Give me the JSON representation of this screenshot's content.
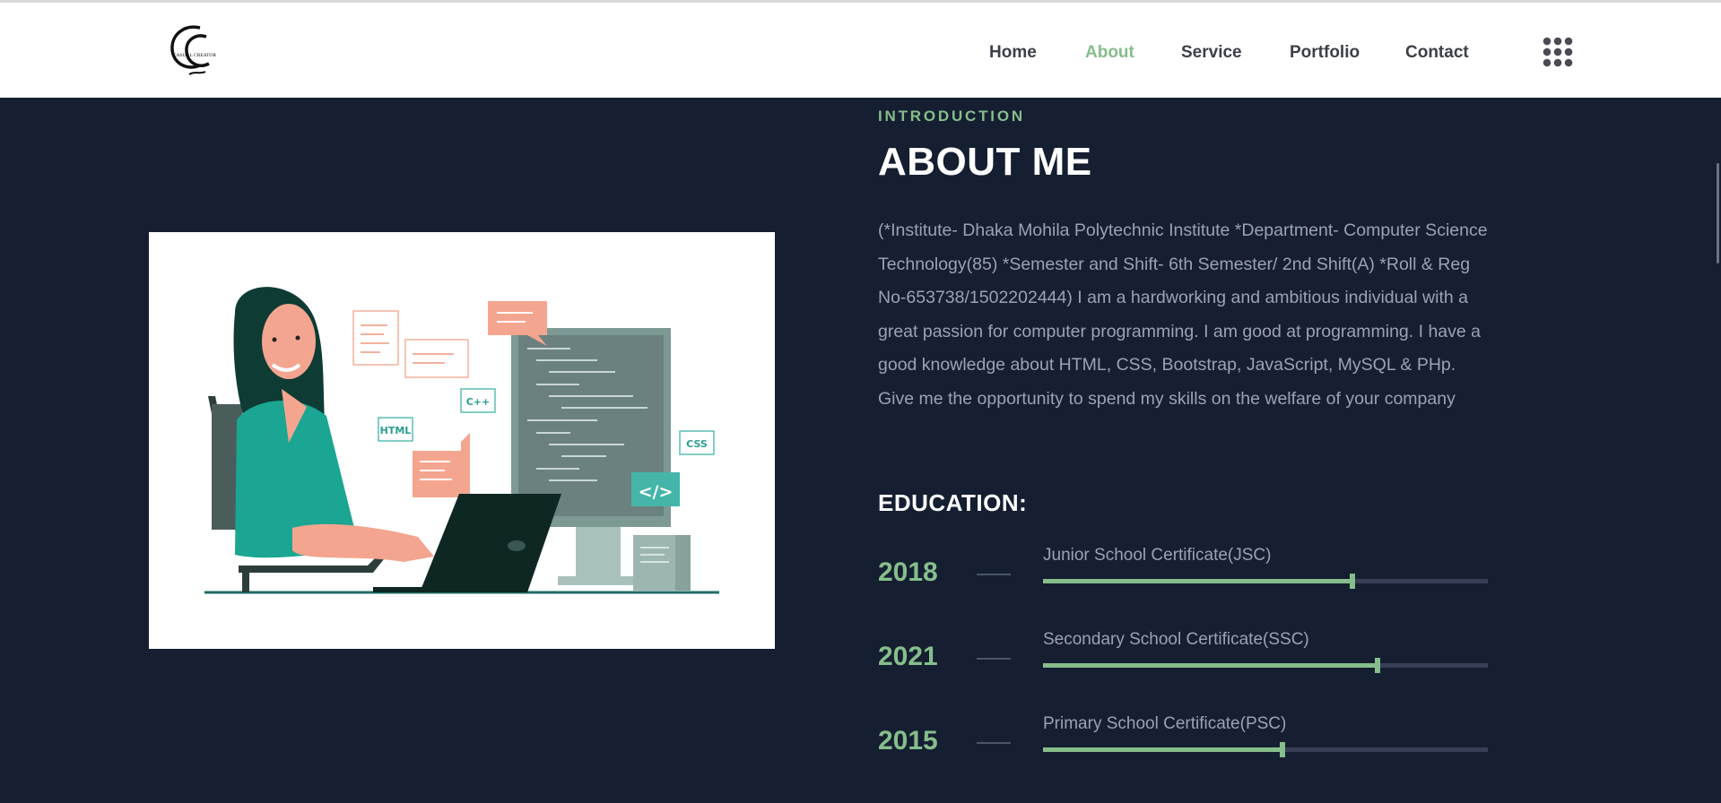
{
  "nav": {
    "items": [
      {
        "label": "Home"
      },
      {
        "label": "About"
      },
      {
        "label": "Service"
      },
      {
        "label": "Portfolio"
      },
      {
        "label": "Contact"
      }
    ],
    "active": "About",
    "logo_text": "CASUAL CREATOR"
  },
  "about": {
    "intro": "INTRODUCTION",
    "title": "ABOUT ME",
    "bio": "(*Institute- Dhaka Mohila Polytechnic Institute *Department- Computer Science Technology(85) *Semester and Shift- 6th Semester/ 2nd Shift(A) *Roll & Reg No-653738/1502202444) I am a hardworking and ambitious individual with a great passion for computer programming. I am good at programming. I have a good knowledge about HTML, CSS, Bootstrap, JavaScript, MySQL & PHp. Give me the opportunity to spend my skills on the welfare of your company",
    "education_title": "EDUCATION:",
    "education": [
      {
        "year": "2018",
        "label": "Junior School Certificate(JSC)",
        "progress": 0.695
      },
      {
        "year": "2021",
        "label": "Secondary School Certificate(SSC)",
        "progress": 0.752
      },
      {
        "year": "2015",
        "label": "Primary School Certificate(PSC)",
        "progress": 0.538
      }
    ]
  },
  "illustration": {
    "tags": [
      "HTML",
      "C++",
      "CSS",
      "</>"
    ]
  },
  "colors": {
    "accent": "#86be8b",
    "background": "#151f31",
    "nav_bg": "#ffffff",
    "nav_text": "#3d3f48",
    "body_text": "#9aa2b5",
    "track": "#383e58"
  }
}
